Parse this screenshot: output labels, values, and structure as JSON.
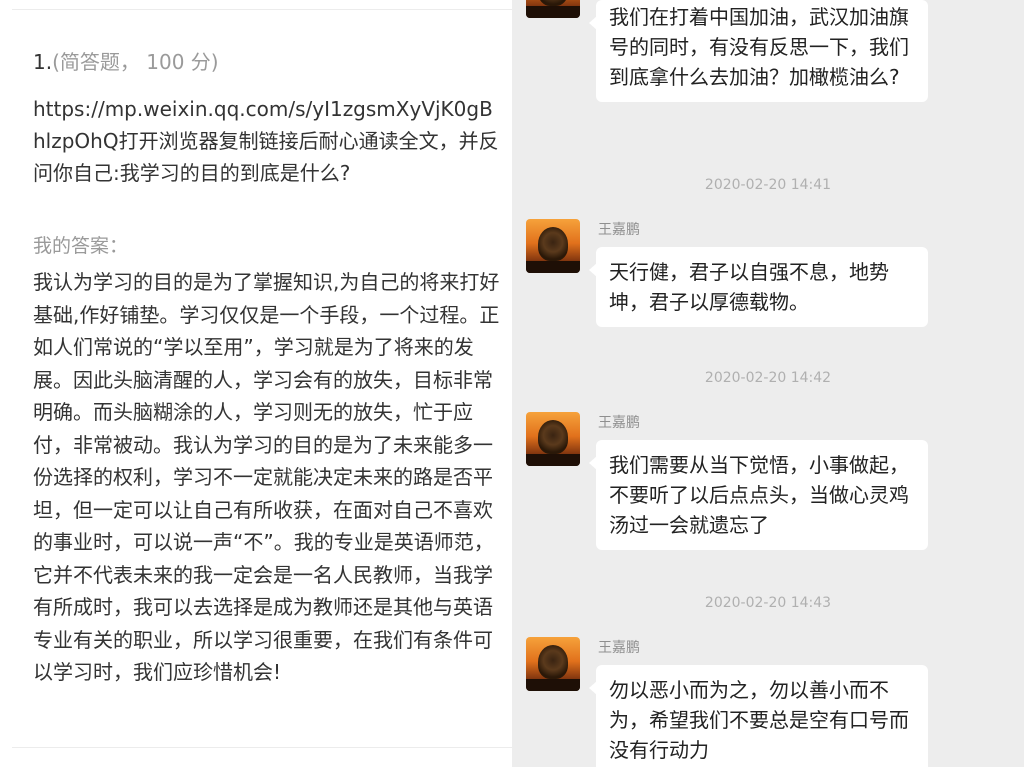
{
  "question": {
    "number": "1.",
    "type_score": "(简答题， 100 分)",
    "text": "https://mp.weixin.qq.com/s/yI1zgsmXyVjK0gBhlzpOhQ打开浏览器复制链接后耐心通读全文，并反问你自己:我学习的目的到底是什么?"
  },
  "answer": {
    "label": "我的答案：",
    "text": "我认为学习的目的是为了掌握知识,为自己的将来打好基础,作好铺垫。学习仅仅是一个手段，一个过程。正如人们常说的“学以至用”，学习就是为了将来的发展。因此头脑清醒的人，学习会有的放失，目标非常明确。而头脑糊涂的人，学习则无的放失，忙于应付，非常被动。我认为学习的目的是为了未来能多一份选择的权利，学习不一定就能决定未来的路是否平坦，但一定可以让自己有所收获，在面对自己不喜欢的事业时，可以说一声“不”。我的专业是英语师范，它并不代表未来的我一定会是一名人民教师，当我学有所成时，我可以去选择是成为教师还是其他与英语专业有关的职业，所以学习很重要，在我们有条件可以学习时，我们应珍惜机会!"
  },
  "chat": {
    "messages": [
      {
        "sender": "",
        "text": "我们在打着中国加油，武汉加油旗号的同时，有没有反思一下，我们到底拿什么去加油？加橄榄油么?"
      },
      {
        "timestamp": "2020-02-20 14:41",
        "sender": "王嘉鹏",
        "text": "天行健，君子以自强不息，地势坤，君子以厚德载物。"
      },
      {
        "timestamp": "2020-02-20 14:42",
        "sender": "王嘉鹏",
        "text": "我们需要从当下觉悟，小事做起，不要听了以后点点头，当做心灵鸡汤过一会就遗忘了"
      },
      {
        "timestamp": "2020-02-20 14:43",
        "sender": "王嘉鹏",
        "text": "勿以恶小而为之，勿以善小而不为，希望我们不要总是空有口号而没有行动力"
      }
    ]
  }
}
